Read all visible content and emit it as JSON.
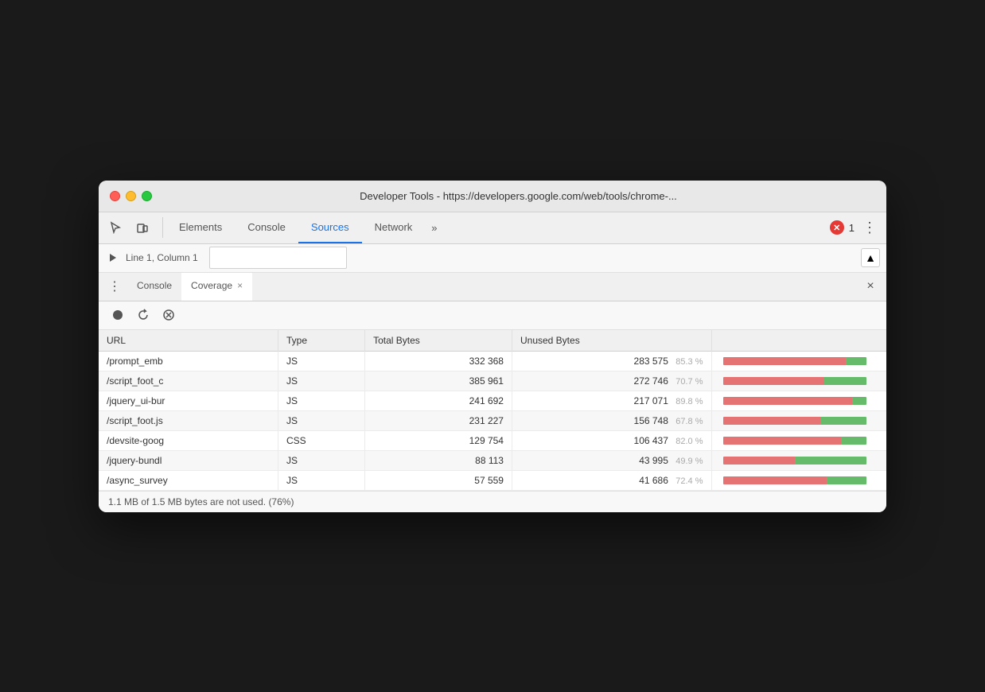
{
  "window": {
    "title": "Developer Tools - https://developers.google.com/web/tools/chrome-..."
  },
  "tabs": {
    "elements": "Elements",
    "console": "Console",
    "sources": "Sources",
    "network": "Network",
    "more": "»"
  },
  "toolbar": {
    "error_count": "1",
    "menu_label": "⋮"
  },
  "secondary_toolbar": {
    "breadcrumb": "Line 1, Column 1"
  },
  "drawer": {
    "console_tab": "Console",
    "coverage_tab": "Coverage",
    "close_label": "×"
  },
  "coverage": {
    "headers": [
      "URL",
      "Type",
      "Total Bytes",
      "Unused Bytes",
      ""
    ],
    "rows": [
      {
        "url": "/prompt_emb",
        "type": "JS",
        "total": "332 368",
        "unused": "283 575",
        "pct": "85.3 %",
        "red_pct": 85.3,
        "green_pct": 14.7
      },
      {
        "url": "/script_foot_c",
        "type": "JS",
        "total": "385 961",
        "unused": "272 746",
        "pct": "70.7 %",
        "red_pct": 70.7,
        "green_pct": 29.3
      },
      {
        "url": "/jquery_ui-bur",
        "type": "JS",
        "total": "241 692",
        "unused": "217 071",
        "pct": "89.8 %",
        "red_pct": 89.8,
        "green_pct": 10.2
      },
      {
        "url": "/script_foot.js",
        "type": "JS",
        "total": "231 227",
        "unused": "156 748",
        "pct": "67.8 %",
        "red_pct": 67.8,
        "green_pct": 32.2
      },
      {
        "url": "/devsite-goog",
        "type": "CSS",
        "total": "129 754",
        "unused": "106 437",
        "pct": "82.0 %",
        "red_pct": 82.0,
        "green_pct": 18.0
      },
      {
        "url": "/jquery-bundl",
        "type": "JS",
        "total": "88 113",
        "unused": "43 995",
        "pct": "49.9 %",
        "red_pct": 49.9,
        "green_pct": 50.1
      },
      {
        "url": "/async_survey",
        "type": "JS",
        "total": "57 559",
        "unused": "41 686",
        "pct": "72.4 %",
        "red_pct": 72.4,
        "green_pct": 27.6
      }
    ],
    "status": "1.1 MB of 1.5 MB bytes are not used. (76%)"
  }
}
